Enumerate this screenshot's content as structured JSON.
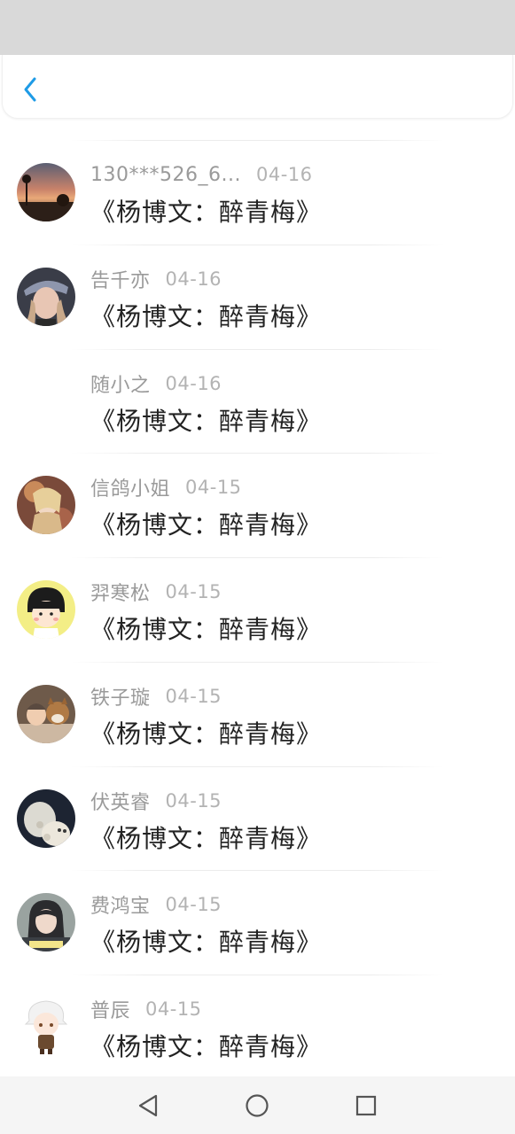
{
  "colors": {
    "accent": "#1e9be6",
    "name_gray": "#9a9a9a",
    "content": "#222222"
  },
  "header": {
    "back_icon": "chevron-left-icon"
  },
  "rows": [
    {
      "name": "130***526_6...",
      "date": "04-16",
      "content": "《杨博文：醉青梅》",
      "avatar": "sunset-landscape"
    },
    {
      "name": "告千亦",
      "date": "04-16",
      "content": "《杨博文：醉青梅》",
      "avatar": "girl-with-cap"
    },
    {
      "name": "随小之",
      "date": "04-16",
      "content": "《杨博文：醉青梅》",
      "avatar": "none"
    },
    {
      "name": "信鸽小姐",
      "date": "04-15",
      "content": "《杨博文：醉青梅》",
      "avatar": "anime-girl"
    },
    {
      "name": "羿寒松",
      "date": "04-15",
      "content": "《杨博文：醉青梅》",
      "avatar": "cartoon-girl"
    },
    {
      "name": "铁子璇",
      "date": "04-15",
      "content": "《杨博文：醉青梅》",
      "avatar": "child-with-dog"
    },
    {
      "name": "伏英睿",
      "date": "04-15",
      "content": "《杨博文：醉青梅》",
      "avatar": "white-plush"
    },
    {
      "name": "费鸿宝",
      "date": "04-15",
      "content": "《杨博文：醉青梅》",
      "avatar": "girl-photo"
    },
    {
      "name": "普辰",
      "date": "04-15",
      "content": "《杨博文：醉青梅》",
      "avatar": "chibi-character"
    }
  ],
  "nav": {
    "back": "triangle-back-icon",
    "home": "circle-home-icon",
    "recent": "square-recents-icon"
  }
}
